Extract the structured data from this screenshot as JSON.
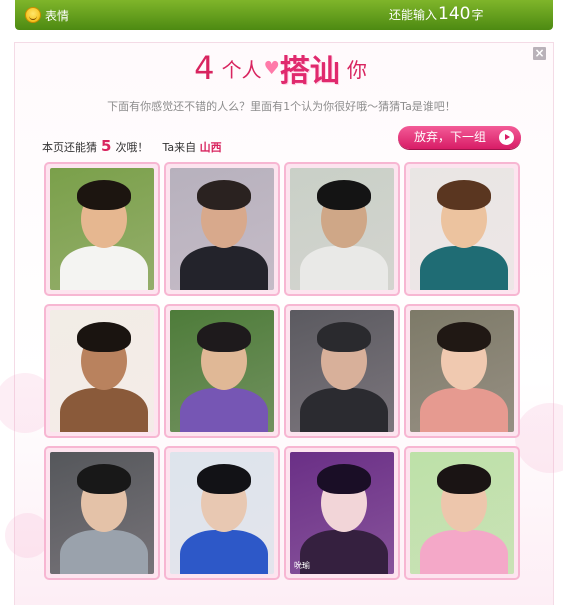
{
  "status_bar": {
    "emoji_label": "表情",
    "remain_prefix": "还能输入",
    "remain_count": "140",
    "remain_suffix": "字"
  },
  "dialog": {
    "close_label": "×",
    "title": {
      "num": "4",
      "prefix": "个人",
      "big": "搭讪",
      "suffix": "你"
    },
    "subtitle": "下面有你感觉还不错的人么？里面有1个认为你很好哦～猜猜Ta是谁吧！",
    "guesses": {
      "prefix": "本页还能猜",
      "count": "5",
      "suffix": "次哦！",
      "origin_prefix": "Ta来自",
      "origin": "山西"
    },
    "next_button": "放弃，下一组"
  },
  "photos": [
    {
      "bg": "#7aa04a",
      "skin": "#e6b790",
      "hair": "#1c1510",
      "cloth": "#f4f4f2",
      "caption": ""
    },
    {
      "bg": "#b7b1bd",
      "skin": "#d8a98c",
      "hair": "#2a2220",
      "cloth": "#23232b",
      "caption": ""
    },
    {
      "bg": "#c9d0c7",
      "skin": "#cfa787",
      "hair": "#141414",
      "cloth": "#e9e9e7",
      "caption": ""
    },
    {
      "bg": "#e9e6e4",
      "skin": "#ecc39f",
      "hair": "#5a3620",
      "cloth": "#1f6c74",
      "caption": ""
    },
    {
      "bg": "#f2ede6",
      "skin": "#b9825e",
      "hair": "#1a1410",
      "cloth": "#8a5a3a",
      "caption": ""
    },
    {
      "bg": "#4e7c3a",
      "skin": "#e0b896",
      "hair": "#1e1a1c",
      "cloth": "#7656b4",
      "caption": ""
    },
    {
      "bg": "#5b5a60",
      "skin": "#d8b09a",
      "hair": "#2a2a2e",
      "cloth": "#2b2b30",
      "caption": ""
    },
    {
      "bg": "#7d7a68",
      "skin": "#f0c9b0",
      "hair": "#201814",
      "cloth": "#e69a90",
      "caption": ""
    },
    {
      "bg": "#55575b",
      "skin": "#e4c2a8",
      "hair": "#181818",
      "cloth": "#9aa2ac",
      "caption": ""
    },
    {
      "bg": "#dde4ec",
      "skin": "#e8c8b2",
      "hair": "#121216",
      "cloth": "#2d58c8",
      "caption": ""
    },
    {
      "bg": "#6a2f86",
      "skin": "#f2d5d8",
      "hair": "#1a0e26",
      "cloth": "#35203f",
      "caption": "吮瑜"
    },
    {
      "bg": "#bde1a8",
      "skin": "#edc6ac",
      "hair": "#1a1414",
      "cloth": "#f4a8c8",
      "caption": ""
    }
  ]
}
